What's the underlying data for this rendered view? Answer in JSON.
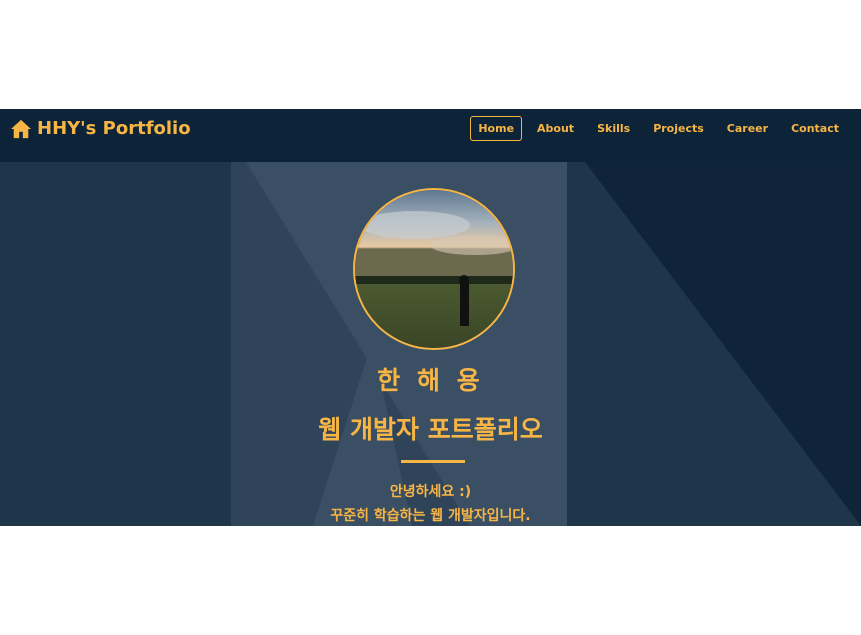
{
  "navbar": {
    "brand": "HHY's Portfolio",
    "brand_icon": "home-icon",
    "links": [
      "Home",
      "About",
      "Skills",
      "Projects",
      "Career",
      "Contact"
    ],
    "active_link": "Home"
  },
  "hero": {
    "name": "한 해 용",
    "subtitle": "웹 개발자 포트폴리오",
    "greeting_line1": "안녕하세요 :)",
    "greeting_line2": "꾸준히 학습하는 웹 개발자입니다."
  },
  "colors": {
    "accent": "#f7b545",
    "nav_background": "#0d2438",
    "hero_background": "#0f2438",
    "panel": "#2f4458"
  }
}
